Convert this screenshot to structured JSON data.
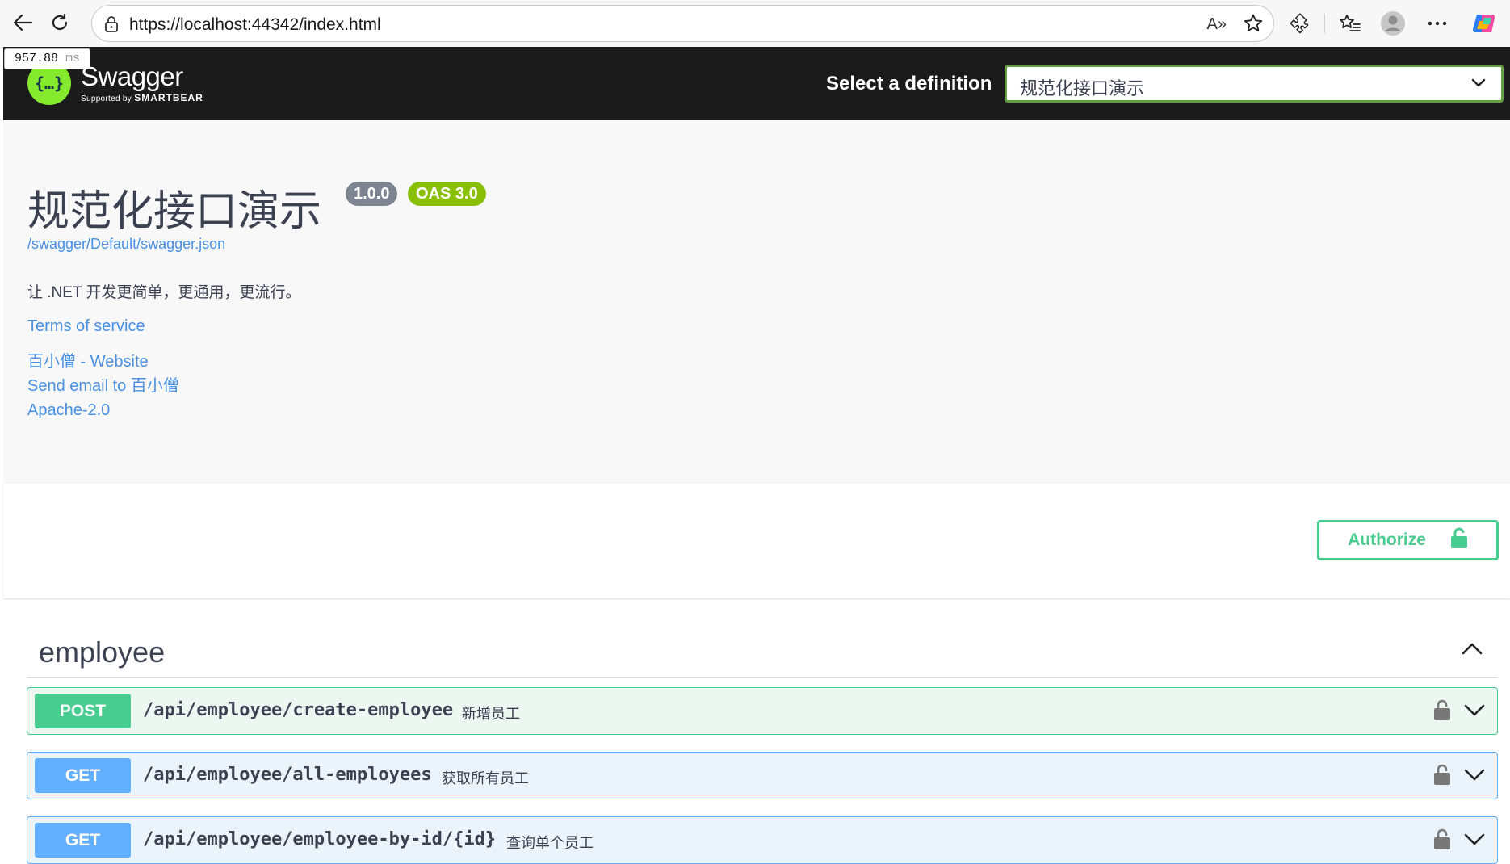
{
  "browser": {
    "url": "https://localhost:44342/index.html",
    "read_aloud": "A»"
  },
  "timing": {
    "value": "957.88",
    "unit": "ms"
  },
  "topbar": {
    "logo_name": "Swagger",
    "logo_supported_by": "Supported by",
    "logo_company": "SMARTBEAR",
    "select_label": "Select a definition",
    "selected_definition": "规范化接口演示"
  },
  "info": {
    "title": "规范化接口演示",
    "version": "1.0.0",
    "oas": "OAS 3.0",
    "spec_url": "/swagger/Default/swagger.json",
    "description": "让 .NET 开发更简单，更通用，更流行。",
    "terms": "Terms of service",
    "website": "百小僧 - Website",
    "email": "Send email to 百小僧",
    "license": "Apache-2.0"
  },
  "authorize": {
    "label": "Authorize"
  },
  "tag": {
    "name": "employee",
    "operations": [
      {
        "method": "POST",
        "path": "/api/employee/create-employee",
        "summary": "新增员工"
      },
      {
        "method": "GET",
        "path": "/api/employee/all-employees",
        "summary": "获取所有员工"
      },
      {
        "method": "GET",
        "path": "/api/employee/employee-by-id/{id}",
        "summary": "查询单个员工"
      }
    ]
  },
  "colors": {
    "post": "#49cc90",
    "get": "#61affe",
    "link": "#4990e2",
    "topbar": "#1b1b1b",
    "select_border": "#62a03f"
  }
}
